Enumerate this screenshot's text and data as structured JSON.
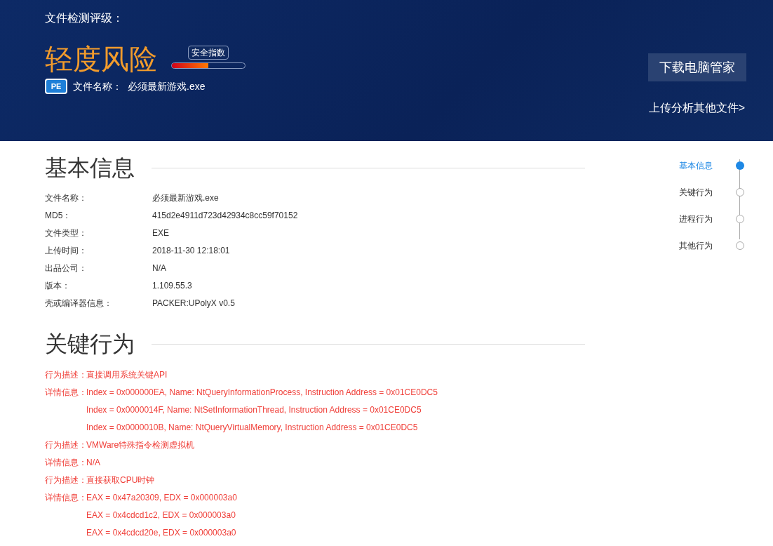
{
  "header": {
    "rating_label": "文件检测评级：",
    "risk": "轻度风险",
    "safety_tooltip": "安全指数",
    "safety": {
      "level": 0.5
    },
    "file_type_badge": "PE",
    "file_name_label": "文件名称：",
    "file_name": "必须最新游戏.exe",
    "download_button": "下载电脑管家",
    "upload_link": "上传分析其他文件>"
  },
  "basic_info": {
    "title": "基本信息",
    "rows": [
      {
        "label": "文件名称：",
        "value": "必须最新游戏.exe"
      },
      {
        "label": "MD5：",
        "value": "415d2e4911d723d42934c8cc59f70152"
      },
      {
        "label": "文件类型：",
        "value": "EXE"
      },
      {
        "label": "上传时间：",
        "value": "2018-11-30 12:18:01"
      },
      {
        "label": "出品公司：",
        "value": "N/A"
      },
      {
        "label": "版本：",
        "value": "1.109.55.3"
      },
      {
        "label": "壳或编译器信息：",
        "value": "PACKER:UPolyX v0.5"
      }
    ]
  },
  "key_behaviors": {
    "title": "关键行为",
    "entries": [
      {
        "label": "行为描述：",
        "lines": [
          "直接调用系统关键API"
        ]
      },
      {
        "label": "详情信息：",
        "lines": [
          "Index = 0x000000EA, Name: NtQueryInformationProcess, Instruction Address = 0x01CE0DC5",
          "Index = 0x0000014F, Name: NtSetInformationThread, Instruction Address = 0x01CE0DC5",
          "Index = 0x0000010B, Name: NtQueryVirtualMemory, Instruction Address = 0x01CE0DC5"
        ]
      },
      {
        "label": "行为描述：",
        "lines": [
          "VMWare特殊指令检测虚拟机"
        ]
      },
      {
        "label": "详情信息：",
        "lines": [
          "N/A"
        ]
      },
      {
        "label": "行为描述：",
        "lines": [
          "直接获取CPU时钟"
        ]
      },
      {
        "label": "详情信息：",
        "lines": [
          "EAX = 0x47a20309, EDX = 0x000003a0",
          "EAX = 0x4cdcd1c2, EDX = 0x000003a0",
          "EAX = 0x4cdcd20e, EDX = 0x000003a0"
        ]
      }
    ]
  },
  "side_nav": [
    {
      "label": "基本信息",
      "selected": true
    },
    {
      "label": "关键行为",
      "selected": false
    },
    {
      "label": "进程行为",
      "selected": false
    },
    {
      "label": "其他行为",
      "selected": false
    }
  ]
}
